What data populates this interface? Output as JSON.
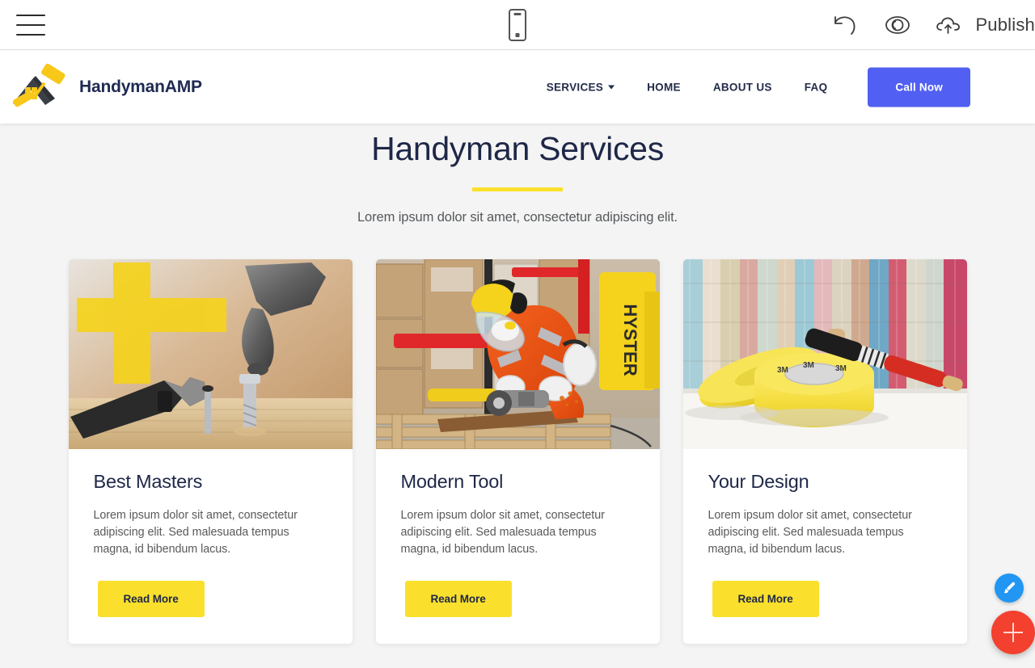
{
  "editor": {
    "menu_icon": "hamburger-menu-icon",
    "device_icon": "mobile-device-icon",
    "undo_icon": "undo-arrow-icon",
    "preview_icon": "eye-preview-icon",
    "publish_icon": "cloud-upload-icon",
    "publish_label": "Publish"
  },
  "site": {
    "brand": {
      "logo_icon": "house-paint-roller-logo",
      "name": "HandymanAMP"
    },
    "nav": {
      "items": [
        {
          "label": "SERVICES",
          "has_caret": true
        },
        {
          "label": "HOME",
          "has_caret": false
        },
        {
          "label": "ABOUT US",
          "has_caret": false
        },
        {
          "label": "FAQ",
          "has_caret": false
        }
      ],
      "cta_label": "Call Now"
    }
  },
  "section": {
    "title": "Handyman Services",
    "subtitle": "Lorem ipsum dolor sit amet, consectetur adipiscing elit."
  },
  "cards": [
    {
      "image_name": "hammer-wrench-screws-on-wood-photo",
      "title": "Best Masters",
      "text": "Lorem ipsum dolor sit amet, consectetur adipiscing elit. Sed malesuada tempus magna, id bibendum lacus.",
      "button_label": "Read More"
    },
    {
      "image_name": "worker-in-orange-coveralls-grinding-photo",
      "title": "Modern Tool",
      "text": "Lorem ipsum dolor sit amet, consectetur adipiscing elit. Sed malesuada tempus magna, id bibendum lacus.",
      "button_label": "Read More"
    },
    {
      "image_name": "masking-tape-rolls-and-paintbrush-photo",
      "title": "Your Design",
      "text": "Lorem ipsum dolor sit amet, consectetur adipiscing elit. Sed malesuada tempus magna, id bibendum lacus.",
      "button_label": "Read More"
    }
  ],
  "fab": {
    "edit_icon": "paintbrush-icon",
    "add_icon": "plus-icon"
  },
  "colors": {
    "accent_yellow": "#fae02c",
    "brand_navy": "#1e2747",
    "cta_blue": "#5160f2",
    "fab_blue": "#2196f3",
    "fab_red": "#f4402e",
    "page_bg": "#f4f4f4"
  }
}
